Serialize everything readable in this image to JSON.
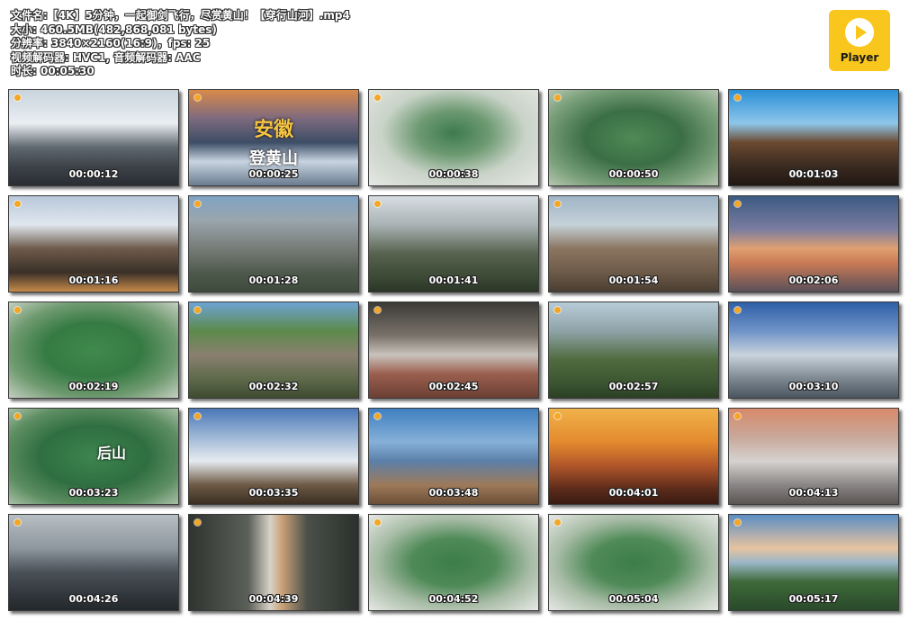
{
  "file_info": {
    "filename": "文件名:【4K】5分钟，一起御剑飞行，尽赏黄山！【穿行山河】.mp4",
    "size": "大小: 460.5MB(482,868,081 bytes)",
    "resolution": "分辨率: 3840×2160(16:9)，fps: 25",
    "codecs": "视频解码器: HVC1, 音频解码器: AAC",
    "duration": "时长: 00:05:30"
  },
  "logo": {
    "label": "Player",
    "icon": "play-icon"
  },
  "thumbnails": [
    {
      "timestamp": "00:00:12",
      "scene": "sea-of-clouds"
    },
    {
      "timestamp": "00:00:25",
      "scene": "title-card",
      "title_line1": "安徽",
      "title_line2": "登黄山"
    },
    {
      "timestamp": "00:00:38",
      "scene": "terrain-map"
    },
    {
      "timestamp": "00:00:50",
      "scene": "terrain-map-closeup"
    },
    {
      "timestamp": "00:01:03",
      "scene": "temple-gate"
    },
    {
      "timestamp": "00:01:16",
      "scene": "cliff-sunset"
    },
    {
      "timestamp": "00:01:28",
      "scene": "granite-peaks"
    },
    {
      "timestamp": "00:01:41",
      "scene": "welcoming-pine"
    },
    {
      "timestamp": "00:01:54",
      "scene": "summit-viewpoint"
    },
    {
      "timestamp": "00:02:06",
      "scene": "dusk-clouds"
    },
    {
      "timestamp": "00:02:19",
      "scene": "terrain-map-labels"
    },
    {
      "timestamp": "00:02:32",
      "scene": "forest-cliffs"
    },
    {
      "timestamp": "00:02:45",
      "scene": "waterfall"
    },
    {
      "timestamp": "00:02:57",
      "scene": "valley-trees"
    },
    {
      "timestamp": "00:03:10",
      "scene": "frosted-peak"
    },
    {
      "timestamp": "00:03:23",
      "scene": "terrain-map-houshan",
      "overlay_text": "后山"
    },
    {
      "timestamp": "00:03:35",
      "scene": "misty-rocks"
    },
    {
      "timestamp": "00:03:48",
      "scene": "blue-ridges"
    },
    {
      "timestamp": "00:04:01",
      "scene": "golden-sunrise"
    },
    {
      "timestamp": "00:04:13",
      "scene": "snowy-crags"
    },
    {
      "timestamp": "00:04:26",
      "scene": "dark-mist"
    },
    {
      "timestamp": "00:04:39",
      "scene": "gorge-waterfall"
    },
    {
      "timestamp": "00:04:52",
      "scene": "terrain-map-overview"
    },
    {
      "timestamp": "00:05:04",
      "scene": "terrain-map-overview"
    },
    {
      "timestamp": "00:05:17",
      "scene": "evening-horizon"
    }
  ],
  "colors": {
    "logo_bg": "#f8c61c",
    "text_outline": "#2b2b2b"
  }
}
